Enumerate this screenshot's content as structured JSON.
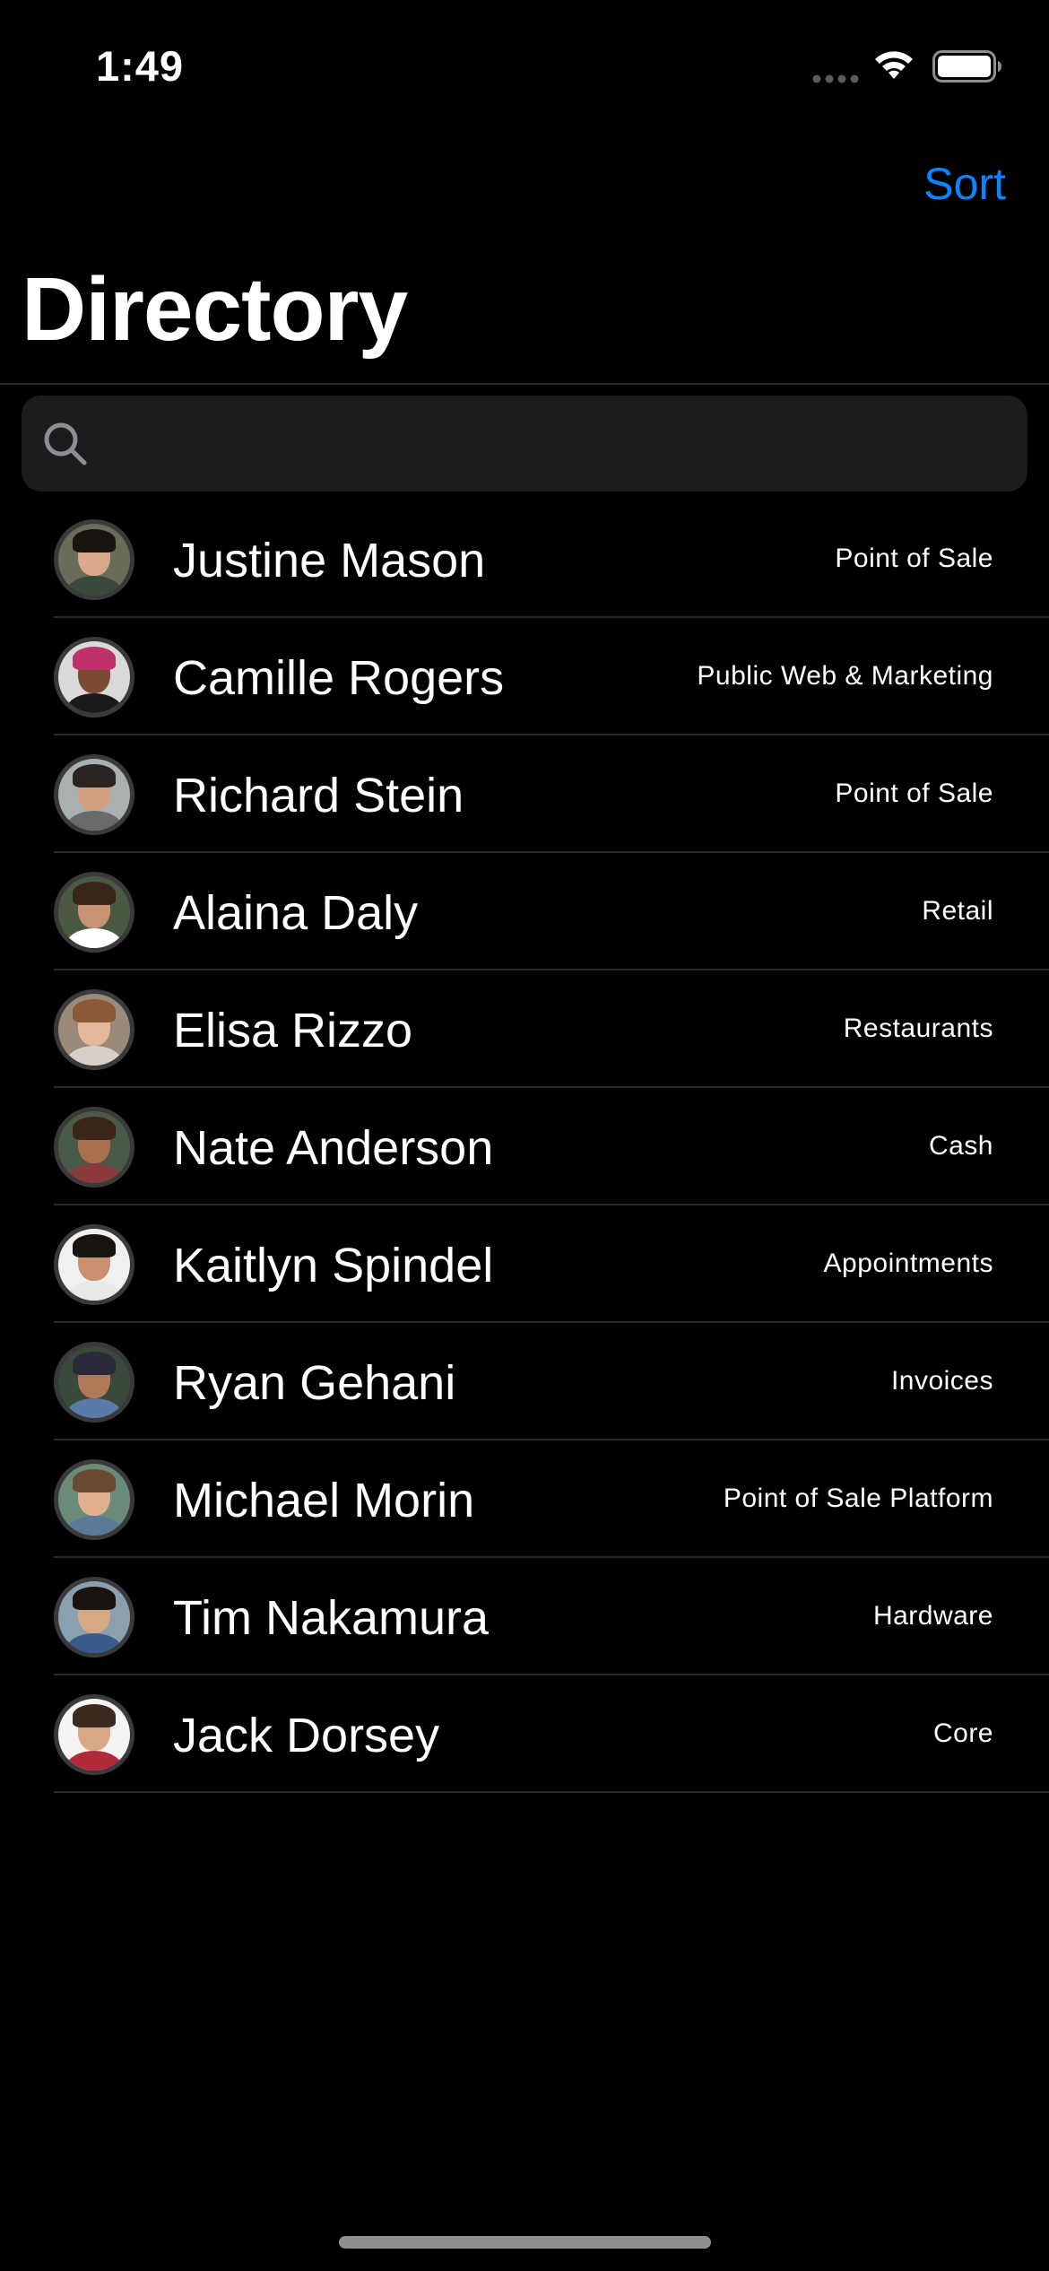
{
  "status_bar": {
    "time": "1:49"
  },
  "nav": {
    "sort_label": "Sort",
    "title": "Directory"
  },
  "search": {
    "placeholder": "",
    "value": ""
  },
  "colors": {
    "background": "#000000",
    "accent": "#0a84ff",
    "divider": "#2a2a2c",
    "search_bg": "#1c1c1e"
  },
  "contacts": [
    {
      "name": "Justine Mason",
      "team": "Point of Sale",
      "avatar": {
        "skin": "#d8a98a",
        "hair": "#1a1410",
        "shirt": "#3a4a3a",
        "bg": "#6b6b5a"
      }
    },
    {
      "name": "Camille Rogers",
      "team": "Public Web & Marketing",
      "avatar": {
        "skin": "#7a4a32",
        "hair": "#c0306a",
        "shirt": "#1a1a1a",
        "bg": "#d9d9d9"
      }
    },
    {
      "name": "Richard Stein",
      "team": "Point of Sale",
      "avatar": {
        "skin": "#d0a080",
        "hair": "#2a2420",
        "shirt": "#6a6a6a",
        "bg": "#aab0b0"
      }
    },
    {
      "name": "Alaina Daly",
      "team": "Retail",
      "avatar": {
        "skin": "#c99272",
        "hair": "#3a2618",
        "shirt": "#ffffff",
        "bg": "#4a5a40"
      }
    },
    {
      "name": "Elisa Rizzo",
      "team": "Restaurants",
      "avatar": {
        "skin": "#e3b99a",
        "hair": "#8a5a38",
        "shirt": "#d8d0c8",
        "bg": "#9a8a7a"
      }
    },
    {
      "name": "Nate Anderson",
      "team": "Cash",
      "avatar": {
        "skin": "#a8704e",
        "hair": "#3a2618",
        "shirt": "#8a3a3a",
        "bg": "#4a5a48"
      }
    },
    {
      "name": "Kaitlyn Spindel",
      "team": "Appointments",
      "avatar": {
        "skin": "#c89070",
        "hair": "#1a1410",
        "shirt": "#e8e8e8",
        "bg": "#f0f0f0"
      }
    },
    {
      "name": "Ryan Gehani",
      "team": "Invoices",
      "avatar": {
        "skin": "#b07a58",
        "hair": "#2a2a3a",
        "shirt": "#5a7aaa",
        "bg": "#3a4a3a"
      }
    },
    {
      "name": "Michael Morin",
      "team": "Point of Sale Platform",
      "avatar": {
        "skin": "#e0b090",
        "hair": "#6a4a30",
        "shirt": "#5a7a9a",
        "bg": "#6a8a7a"
      }
    },
    {
      "name": "Tim Nakamura",
      "team": "Hardware",
      "avatar": {
        "skin": "#d8a880",
        "hair": "#1a1410",
        "shirt": "#3a5a8a",
        "bg": "#8aa0b0"
      }
    },
    {
      "name": "Jack Dorsey",
      "team": "Core",
      "avatar": {
        "skin": "#d8a888",
        "hair": "#3a2a20",
        "shirt": "#b02a3a",
        "bg": "#f4f4f4"
      }
    }
  ]
}
